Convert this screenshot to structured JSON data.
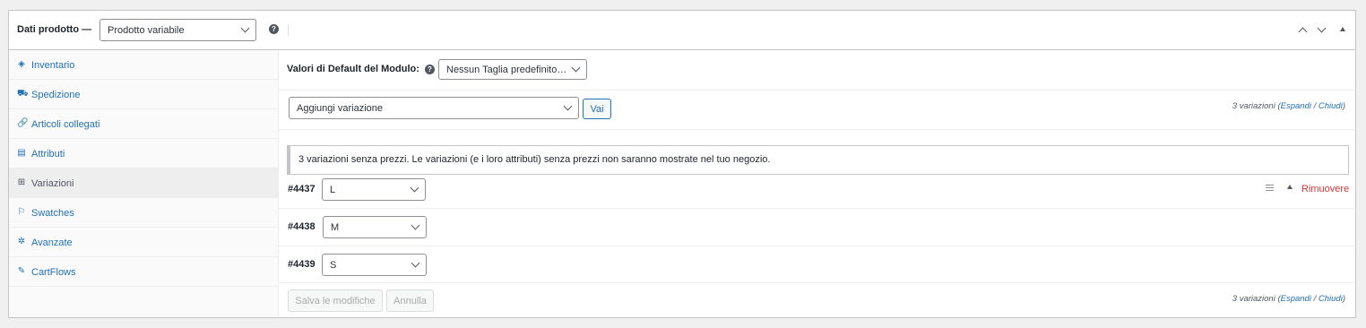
{
  "header": {
    "title": "Dati prodotto —",
    "product_type": "Prodotto variabile",
    "help": "?"
  },
  "sidebar": {
    "items": [
      {
        "label": "Inventario",
        "icon": "tag-icon",
        "glyph": "◈"
      },
      {
        "label": "Spedizione",
        "icon": "truck-icon",
        "glyph": "⛟"
      },
      {
        "label": "Articoli collegati",
        "icon": "link-icon",
        "glyph": "🔗"
      },
      {
        "label": "Attributi",
        "icon": "list-icon",
        "glyph": "▤"
      },
      {
        "label": "Variazioni",
        "icon": "grid-icon",
        "glyph": "⊞"
      },
      {
        "label": "Swatches",
        "icon": "swatch-icon",
        "glyph": "⚐"
      },
      {
        "label": "Avanzate",
        "icon": "gear-icon",
        "glyph": "✲"
      },
      {
        "label": "CartFlows",
        "icon": "wrench-icon",
        "glyph": "✎"
      }
    ],
    "active_index": 4
  },
  "defaults": {
    "label": "Valori di Default del Modulo:",
    "help": "?",
    "value": "Nessun Taglia predefinito…"
  },
  "toolbar": {
    "action_value": "Aggiungi variazione",
    "go_label": "Vai",
    "count_prefix": "3 variazioni (",
    "expand": "Espandi",
    "slash": " / ",
    "close": "Chiudi",
    "count_suffix": ")"
  },
  "notice": "3 variazioni senza prezzi. Le variazioni (e i loro attributi) senza prezzi non saranno mostrate nel tuo negozio.",
  "variations": [
    {
      "id": "#4437",
      "size": "L",
      "remove": "Rimuovere"
    },
    {
      "id": "#4438",
      "size": "M"
    },
    {
      "id": "#4439",
      "size": "S"
    }
  ],
  "footer": {
    "save_label": "Salva le modifiche",
    "cancel_label": "Annulla"
  },
  "colors": {
    "link": "#2271b1",
    "danger": "#d63638",
    "border": "#c3c4c7"
  }
}
